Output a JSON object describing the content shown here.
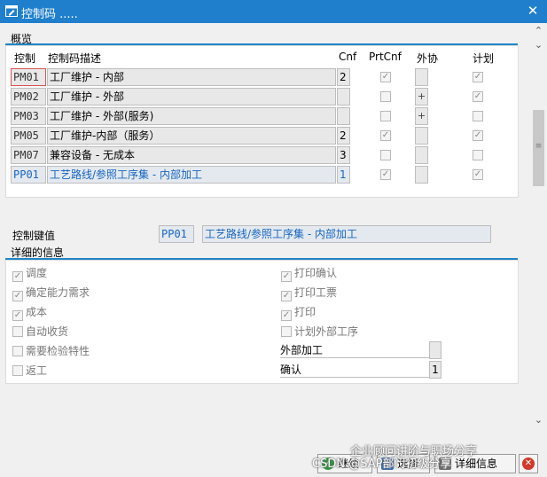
{
  "window": {
    "title": "控制码 ....."
  },
  "overview": {
    "section_title": "概览",
    "headers": {
      "key": "控制",
      "desc": "控制码描述",
      "cnf": "Cnf",
      "prtcnf": "PrtCnf",
      "external": "外协",
      "plan": "计划"
    },
    "rows": [
      {
        "key": "PM01",
        "desc": "工厂维护 - 内部",
        "cnf": "2",
        "prtcnf": true,
        "external": "",
        "plan": true,
        "selected": true,
        "highlight": false
      },
      {
        "key": "PM02",
        "desc": "工厂维护 - 外部",
        "cnf": "",
        "prtcnf": false,
        "external": "+",
        "plan": true,
        "selected": false,
        "highlight": false
      },
      {
        "key": "PM03",
        "desc": "工厂维护 - 外部(服务)",
        "cnf": "",
        "prtcnf": false,
        "external": "+",
        "plan": false,
        "selected": false,
        "highlight": false
      },
      {
        "key": "PM05",
        "desc": "工厂维护-内部（服务）",
        "cnf": "2",
        "prtcnf": true,
        "external": "",
        "plan": true,
        "selected": false,
        "highlight": false
      },
      {
        "key": "PM07",
        "desc": "兼容设备 - 无成本",
        "cnf": "3",
        "prtcnf": false,
        "external": "",
        "plan": false,
        "selected": false,
        "highlight": false
      },
      {
        "key": "PP01",
        "desc": "工艺路线/参照工序集 - 内部加工",
        "cnf": "1",
        "prtcnf": true,
        "external": "",
        "plan": true,
        "selected": false,
        "highlight": true
      }
    ]
  },
  "key_value": {
    "label": "控制键值",
    "key": "PP01",
    "desc": "工艺路线/参照工序集 - 内部加工"
  },
  "details": {
    "section_title": "详细的信息",
    "left": [
      {
        "label": "调度",
        "checked": true
      },
      {
        "label": "确定能力需求",
        "checked": true
      },
      {
        "label": "成本",
        "checked": true
      },
      {
        "label": "自动收货",
        "checked": false
      },
      {
        "label": "需要检验特性",
        "checked": false
      },
      {
        "label": "返工",
        "checked": false
      }
    ],
    "right": [
      {
        "label": "打印确认",
        "checked": true
      },
      {
        "label": "打印工票",
        "checked": true
      },
      {
        "label": "打印",
        "checked": true
      },
      {
        "label": "计划外部工序",
        "checked": false
      }
    ],
    "fields": [
      {
        "label": "外部加工",
        "value": ""
      },
      {
        "label": "确认",
        "value": "1"
      }
    ]
  },
  "footer": {
    "buttons": [
      {
        "label": "继续",
        "icon": "check-icon"
      },
      {
        "label": "选择",
        "icon": "select-icon"
      },
      {
        "label": "详细信息",
        "icon": "details-icon"
      }
    ],
    "watermark_line1": "企业顾问讲阶与职场分享",
    "watermark_line2": "CSDN @SAP部门初级分享"
  },
  "colors": {
    "titlebar": "#1f7fcd",
    "accent_line": "#1e86c6",
    "highlight_text": "#1565c0",
    "close_button": "#d23a2b"
  }
}
